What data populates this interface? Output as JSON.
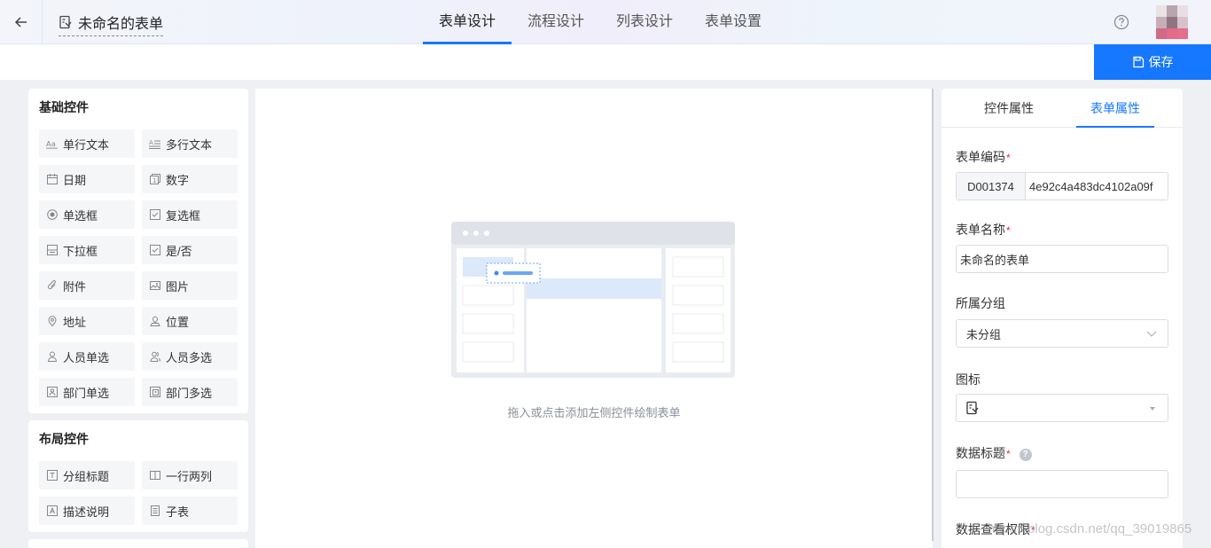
{
  "header": {
    "form_title": "未命名的表单",
    "tabs": [
      {
        "label": "表单设计",
        "active": true
      },
      {
        "label": "流程设计",
        "active": false
      },
      {
        "label": "列表设计",
        "active": false
      },
      {
        "label": "表单设置",
        "active": false
      }
    ]
  },
  "toolbar": {
    "save_label": "保存"
  },
  "basic_controls": {
    "title": "基础控件",
    "items": [
      {
        "label": "单行文本",
        "icon": "single-line-text-icon"
      },
      {
        "label": "多行文本",
        "icon": "multi-line-text-icon"
      },
      {
        "label": "日期",
        "icon": "calendar-icon"
      },
      {
        "label": "数字",
        "icon": "number-icon"
      },
      {
        "label": "单选框",
        "icon": "radio-icon"
      },
      {
        "label": "复选框",
        "icon": "checkbox-icon"
      },
      {
        "label": "下拉框",
        "icon": "dropdown-icon"
      },
      {
        "label": "是/否",
        "icon": "yes-no-icon"
      },
      {
        "label": "附件",
        "icon": "paperclip-icon"
      },
      {
        "label": "图片",
        "icon": "image-icon"
      },
      {
        "label": "地址",
        "icon": "map-pin-icon"
      },
      {
        "label": "位置",
        "icon": "location-icon"
      },
      {
        "label": "人员单选",
        "icon": "user-icon"
      },
      {
        "label": "人员多选",
        "icon": "users-icon"
      },
      {
        "label": "部门单选",
        "icon": "department-icon"
      },
      {
        "label": "部门多选",
        "icon": "departments-icon"
      }
    ]
  },
  "layout_controls": {
    "title": "布局控件",
    "items": [
      {
        "label": "分组标题",
        "icon": "group-title-icon"
      },
      {
        "label": "一行两列",
        "icon": "two-columns-icon"
      },
      {
        "label": "描述说明",
        "icon": "description-icon"
      },
      {
        "label": "子表",
        "icon": "subtable-icon"
      }
    ]
  },
  "canvas": {
    "empty_hint": "拖入或点击添加左侧控件绘制表单"
  },
  "properties": {
    "tabs": [
      {
        "label": "控件属性",
        "active": false
      },
      {
        "label": "表单属性",
        "active": true
      }
    ],
    "form_code": {
      "label": "表单编码",
      "prefix": "D001374",
      "value": "4e92c4a483dc4102a09f"
    },
    "form_name": {
      "label": "表单名称",
      "value": "未命名的表单"
    },
    "group": {
      "label": "所属分组",
      "value": "未分组"
    },
    "icon": {
      "label": "图标"
    },
    "data_title": {
      "label": "数据标题",
      "value": ""
    },
    "data_permission": {
      "label": "数据查看权限"
    }
  },
  "watermark": "https://blog.csdn.net/qq_39019865",
  "colors": {
    "accent": "#1677ff",
    "required": "#f5222d"
  }
}
